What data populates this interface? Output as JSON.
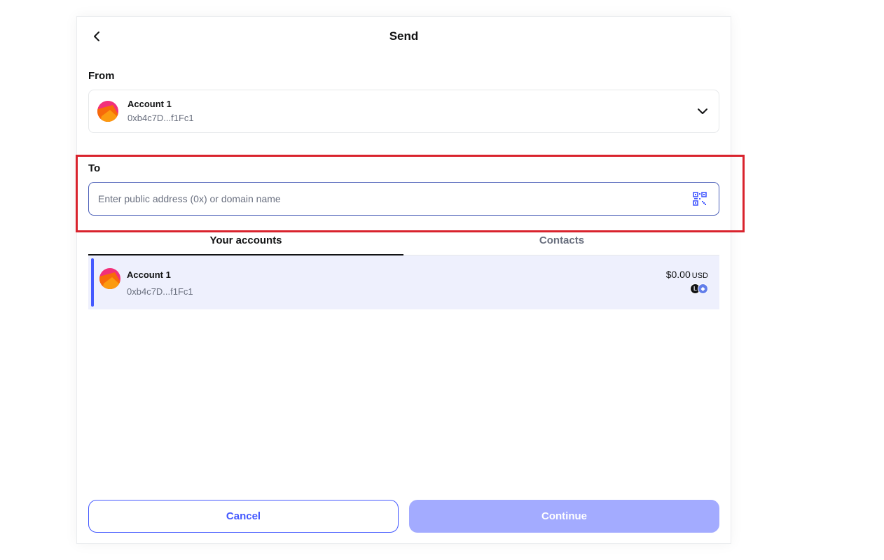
{
  "header": {
    "title": "Send"
  },
  "from": {
    "label": "From",
    "account_name": "Account 1",
    "account_address": "0xb4c7D...f1Fc1"
  },
  "to": {
    "label": "To",
    "placeholder": "Enter public address (0x) or domain name",
    "value": ""
  },
  "tabs": [
    {
      "label": "Your accounts",
      "active": true
    },
    {
      "label": "Contacts",
      "active": false
    }
  ],
  "accounts": [
    {
      "name": "Account 1",
      "address": "0xb4c7D...f1Fc1",
      "balance": "$0.00",
      "currency": "USD",
      "networks": [
        "linea-icon",
        "ethereum-icon"
      ]
    }
  ],
  "footer": {
    "cancel_label": "Cancel",
    "continue_label": "Continue"
  },
  "colors": {
    "accent": "#4459ff",
    "continue_disabled": "#a3abff",
    "selected_row": "#eef0fd",
    "highlight": "#d9232d"
  }
}
